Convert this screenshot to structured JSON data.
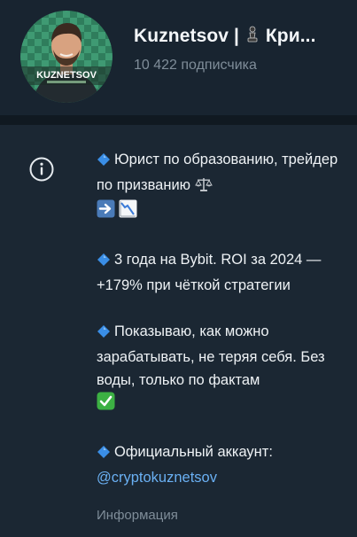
{
  "header": {
    "channel_name_part1": "Kuznetsov |",
    "channel_name_part2": "Кри...",
    "subscribers": "10 422 подписчика",
    "avatar_text": "KUZNETSOV",
    "avatar_icon": "pawn-icon"
  },
  "info": {
    "icon": "info-icon",
    "para1_line": "Юрист по образованию, трейдер по призванию",
    "para2": "3 года на Bybit. ROI за 2024 — +179% при чёткой стратегии",
    "para3": "Показываю, как можно зарабатывать, не теряя себя. Без воды, только по фактам",
    "para4_text": "Официальный аккаунт:",
    "para4_link": "@cryptokuznetsov",
    "caption": "Информация"
  },
  "colors": {
    "background": "#1b2733",
    "link": "#6ab0f3",
    "secondary_text": "#7f8d99"
  }
}
